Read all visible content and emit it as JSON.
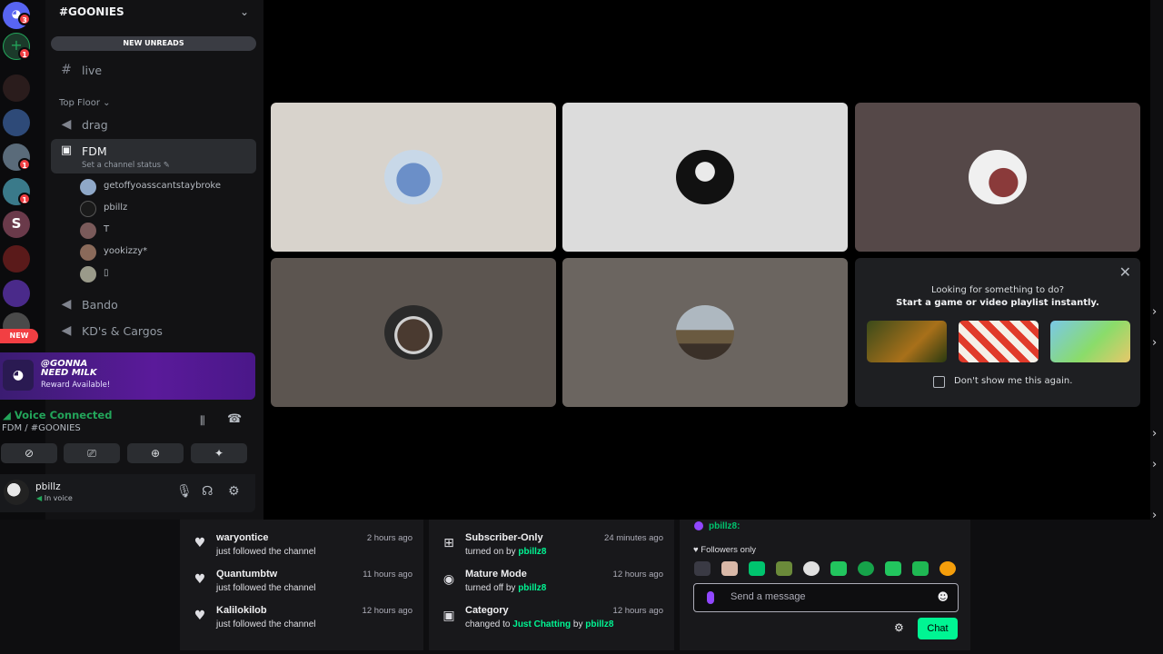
{
  "guilds": {
    "discord_badge": "3",
    "add_badge": "1",
    "badges": [
      "1",
      "1",
      "1"
    ],
    "new_pill": "NEW"
  },
  "server": {
    "name": "#GOONIES",
    "new_unreads": "NEW UNREADS",
    "channels": [
      {
        "icon": "#",
        "name": "live"
      }
    ],
    "category": "Top Floor ⌄",
    "voice_channels_top": [
      {
        "name": "drag"
      }
    ],
    "active_channel": {
      "name": "FDM",
      "status": "Set a channel status ✎",
      "users": [
        "getoffyoasscantstaybroke",
        "pbillz",
        "T",
        "yookizzy*",
        "▯"
      ]
    },
    "voice_channels_bottom": [
      {
        "name": "Bando"
      },
      {
        "name": "KD's & Cargos"
      }
    ]
  },
  "nitro": {
    "title_line1": "@GONNA",
    "title_line2": "NEED MILK",
    "subtitle": "Reward Available!"
  },
  "voice": {
    "status": "Voice Connected",
    "location": "FDM / #GOONIES"
  },
  "user": {
    "name": "pbillz",
    "status": "In voice"
  },
  "activity": {
    "line1": "Looking for something to do?",
    "line2": "Start a game or video playlist instantly.",
    "checkbox_label": "Don't show me this again."
  },
  "activity_feed_1": [
    {
      "name": "waryontice",
      "sub": "just followed the channel",
      "time": "2 hours ago"
    },
    {
      "name": "Quantumbtw",
      "sub": "just followed the channel",
      "time": "11 hours ago"
    },
    {
      "name": "Kalilokilob",
      "sub": "just followed the channel",
      "time": "12 hours ago"
    }
  ],
  "activity_feed_2": [
    {
      "name": "Subscriber-Only",
      "sub_pre": "turned on by ",
      "sub_hl": "pbillz8",
      "time": "24 minutes ago"
    },
    {
      "name": "Mature Mode",
      "sub_pre": "turned off by ",
      "sub_hl": "pbillz8",
      "time": "12 hours ago"
    },
    {
      "name": "Category",
      "sub_pre": "changed to ",
      "sub_hl": "Just Chatting",
      "sub_mid": " by ",
      "sub_hl2": "pbillz8",
      "time": "12 hours ago"
    }
  ],
  "chat": {
    "last_user": "pbillz8:",
    "mode": "♥ Followers only",
    "placeholder": "Send a message",
    "button": "Chat"
  },
  "colors": {
    "voice_green": "#23a55a",
    "twitch_green": "#00f593",
    "badge_red": "#f23f43"
  }
}
